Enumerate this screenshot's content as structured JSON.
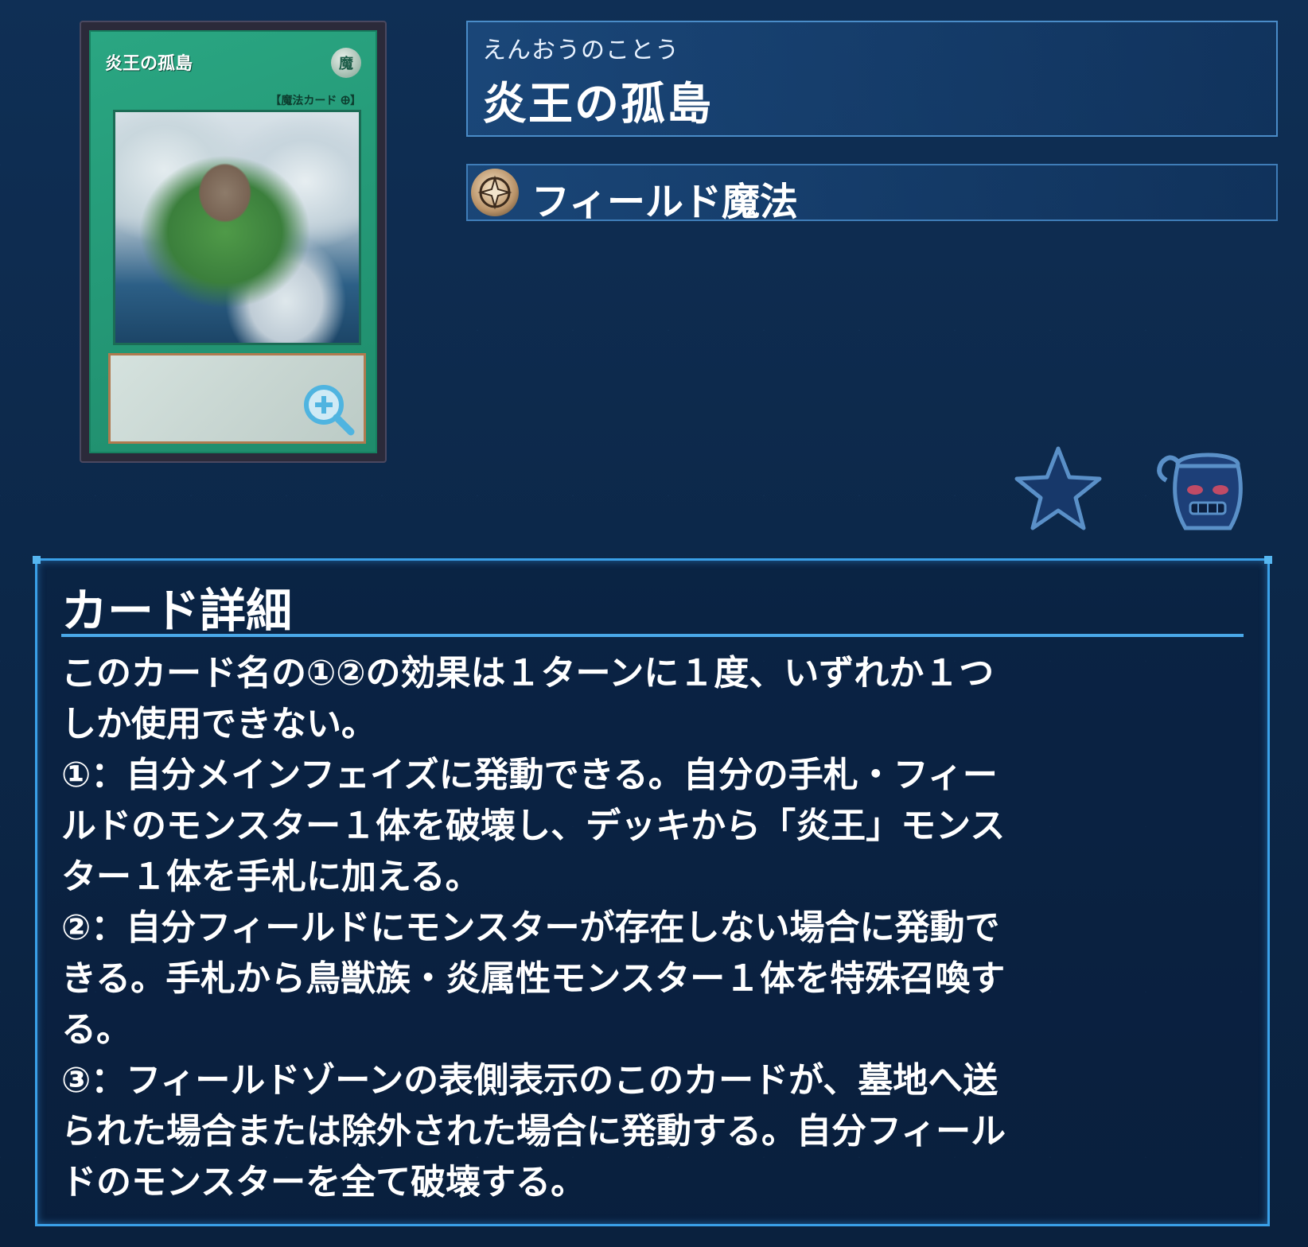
{
  "card_image": {
    "name": "炎王の孤島",
    "attribute_symbol": "魔",
    "type_line": "【魔法カード 🜨】"
  },
  "card_info": {
    "ruby": "えんおうのことう",
    "name": "炎王の孤島",
    "type_label": "フィールド魔法",
    "type_icon": "field-spell-icon"
  },
  "actions": {
    "favorite_icon": "star-icon",
    "pot_icon": "pot-of-greed-icon"
  },
  "detail": {
    "heading": "カード詳細",
    "text": "このカード名の①②の効果は１ターンに１度、いずれか１つ\nしか使用できない。\n①：自分メインフェイズに発動できる。自分の手札・フィー\nルドのモンスター１体を破壊し、デッキから「炎王」モンス\nター１体を手札に加える。\n②：自分フィールドにモンスターが存在しない場合に発動で\nきる。手札から鳥獣族・炎属性モンスター１体を特殊召喚す\nる。\n③：フィールドゾーンの表側表示のこのカードが、墓地へ送\nられた場合または除外された場合に発動する。自分フィール\nドのモンスターを全て破壊する。"
  },
  "colors": {
    "background": "#0c2748",
    "accent": "#3aa0e8",
    "card_green": "#2aa682"
  }
}
